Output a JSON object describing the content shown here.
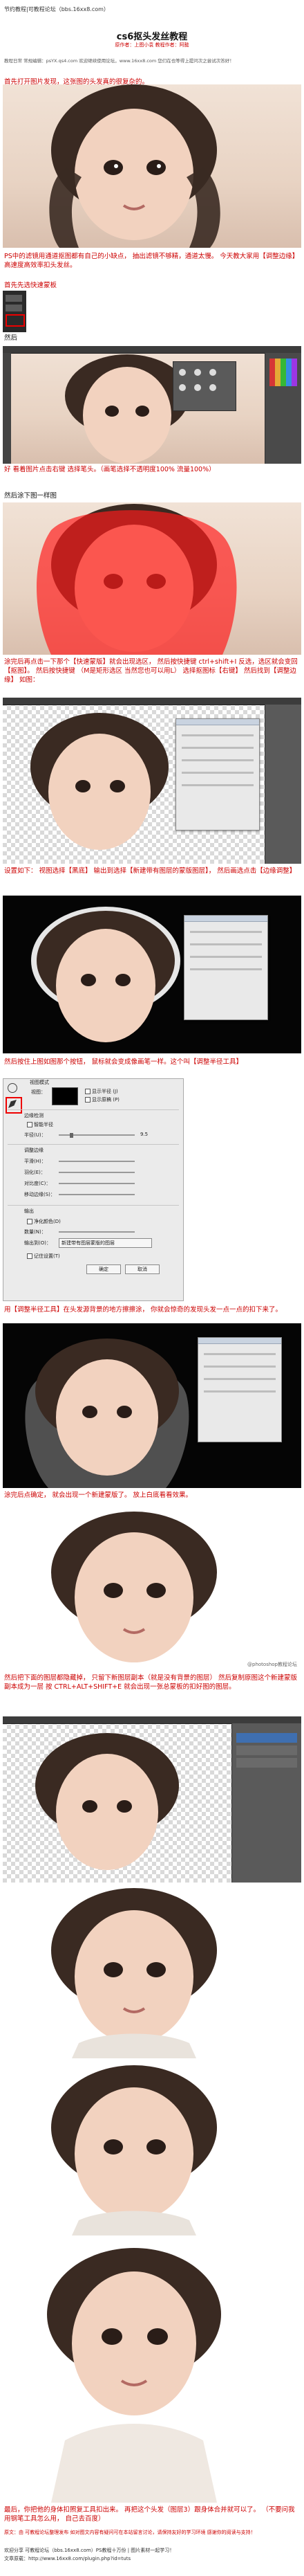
{
  "header": {
    "site_line": "节约教程|可教程论坛（bbs.16xx8.com）",
    "title": "cs6抠头发丝教程",
    "subtitle": "原作者：上图小袁 教程作者：阿懿",
    "intro": "教程日常 常规编辑：psYX.qs4.com 欢迎继续使用论坛，www.16xx8.com 您们在也等得上提问次之尝试次答好！"
  },
  "steps": {
    "s1": "首先打开图片发现，这张图的头发真的很复杂的。",
    "s2": "PS中的滤镜用通道抠图都有自己的小缺点， 抽出滤镜不够精，通道太慢。 今天教大家用【调整边缘】高速度高效率扣头发丝。",
    "s2b": "首先先选快速蒙板",
    "s3": "然后",
    "s3b": "好 看着图片点击右键 选择笔头。（画笔选择不透明度100% 流量100%）",
    "s4": "然后涂下图一样图",
    "s5": "涂完后再点击一下那个【快速蒙版】就会出现选区， 然后按快捷键 ctrl+shift+I 反选，选区就会变回【抠图】。 然后按快捷键 （M是矩形选区 当然您也可以用L） 选择抠图标【右键】 然后找到【调整边缘】 如图：",
    "s6": "设置如下： 视图选择【黑底】 输出到选择【新建带有图层的蒙版图层】， 然后画选点击【边缘调整】",
    "s7": "然后按住上图如图那个按钮， 鼠标就会变成像画笔一样。这个叫【调整半径工具】",
    "s8": "用【调整半径工具】在头发源背景的地方擦擦涂， 你就会惊奇的发现头发一点一点的扣下来了。",
    "s9": "涂完后点确定， 就会出现一个新建蒙版了。 放上白底看看效果。",
    "s10": "然后把下面的图层都隐藏掉， 只留下新图层副本（就是没有背景的图层） 然后复制原图这个新建蒙版副本成为一层 按 CTRL+ALT+SHIFT+E 就会出现一张总蒙板的扣好图的图层。",
    "s11": "最后，你把他的身体扣照复工具扣出来。 再把这个头发（图层3）跟身体合并就可以了。 （不要问我用钢笔工具怎么用， 自己去百度）"
  },
  "panels": {
    "refine_title": "视图模式",
    "refine_view": "视图：",
    "show_radius": "显示半径 (J)",
    "show_original": "显示原稿 (P)",
    "edge_detect": "边缘检测",
    "smart_radius": "智能半径",
    "radius": "半径(U)：",
    "radius_val": "9.5",
    "adjust_edge": "调整边缘",
    "smooth": "平滑(H)：",
    "feather": "羽化(E)：",
    "contrast": "对比度(C)：",
    "shift_edge": "移动边缘(S)：",
    "output": "输出",
    "decontaminate": "净化颜色(D)",
    "amount": "数量(N)：",
    "output_to": "输出到(O)：",
    "output_value": "新建带有图层蒙版的图层",
    "remember": "记住设置(T)",
    "ok": "确定",
    "cancel": "取消"
  },
  "watermark": "@photoshop教程论坛",
  "footer": {
    "note": "原文：由 可教程论坛整理发布 如对图文内容有疑问可在本站留言讨论，请保持友好的学习环境 感谢你的阅读与支持！",
    "more": "欢迎分享 可教程论坛（bbs.16xx8.com）PS教程十万份 | 图片素材一起学习！",
    "link": "文章原载：http://www.16xx8.com/plugin.php?id=tuts"
  }
}
